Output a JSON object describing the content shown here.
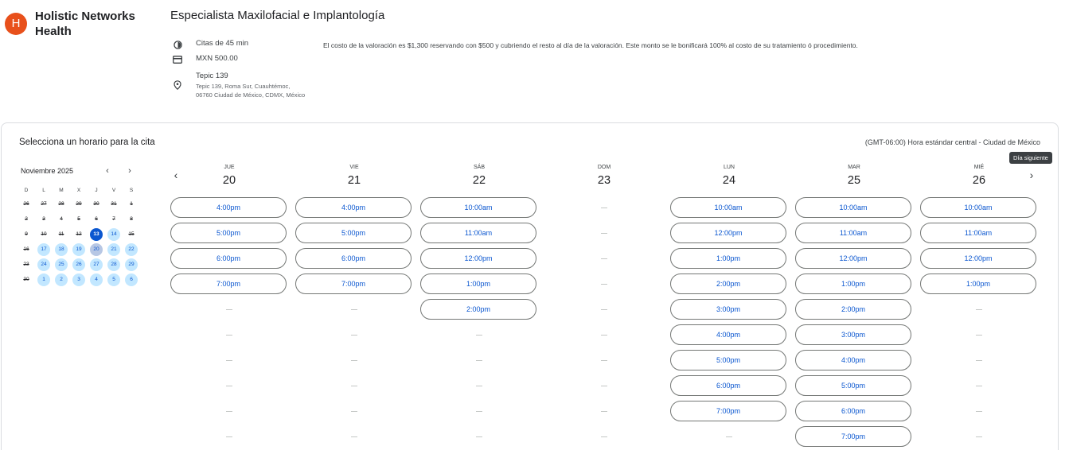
{
  "org": {
    "initial": "H",
    "name": "Holistic Networks Health"
  },
  "service": {
    "title": "Especialista Maxilofacial e Implantología",
    "duration": "Citas de 45 min",
    "price": "MXN 500.00",
    "location_name": "Tepic 139",
    "location_address": "Tepic 139, Roma Sur, Cuauhtémoc, 06760 Ciudad de México, CDMX, México",
    "description": "El costo de la valoración es $1,300 reservando con $500 y cubriendo el resto al día de la valoración. Este monto se le bonificará  100% al costo de su tratamiento ó procedimiento."
  },
  "panel": {
    "title": "Selecciona un horario para la cita",
    "timezone": "(GMT-06:00) Hora estándar central - Ciudad de México",
    "tooltip": "Día siguiente"
  },
  "calendar": {
    "month": "Noviembre 2025",
    "weekdays": [
      "D",
      "L",
      "M",
      "X",
      "J",
      "V",
      "S"
    ],
    "days": [
      {
        "d": "26",
        "state": "disabled"
      },
      {
        "d": "27",
        "state": "disabled"
      },
      {
        "d": "28",
        "state": "disabled"
      },
      {
        "d": "29",
        "state": "disabled"
      },
      {
        "d": "30",
        "state": "disabled"
      },
      {
        "d": "31",
        "state": "disabled"
      },
      {
        "d": "1",
        "state": "disabled"
      },
      {
        "d": "2",
        "state": "disabled"
      },
      {
        "d": "3",
        "state": "disabled"
      },
      {
        "d": "4",
        "state": "disabled"
      },
      {
        "d": "5",
        "state": "disabled"
      },
      {
        "d": "6",
        "state": "disabled"
      },
      {
        "d": "7",
        "state": "disabled"
      },
      {
        "d": "8",
        "state": "disabled"
      },
      {
        "d": "9",
        "state": "disabled"
      },
      {
        "d": "10",
        "state": "disabled"
      },
      {
        "d": "11",
        "state": "disabled"
      },
      {
        "d": "12",
        "state": "disabled"
      },
      {
        "d": "13",
        "state": "today"
      },
      {
        "d": "14",
        "state": "available"
      },
      {
        "d": "15",
        "state": "disabled"
      },
      {
        "d": "16",
        "state": "disabled"
      },
      {
        "d": "17",
        "state": "available"
      },
      {
        "d": "18",
        "state": "available"
      },
      {
        "d": "19",
        "state": "available"
      },
      {
        "d": "20",
        "state": "selected"
      },
      {
        "d": "21",
        "state": "available"
      },
      {
        "d": "22",
        "state": "available"
      },
      {
        "d": "23",
        "state": "disabled"
      },
      {
        "d": "24",
        "state": "available"
      },
      {
        "d": "25",
        "state": "available"
      },
      {
        "d": "26",
        "state": "available"
      },
      {
        "d": "27",
        "state": "available"
      },
      {
        "d": "28",
        "state": "available"
      },
      {
        "d": "29",
        "state": "available"
      },
      {
        "d": "30",
        "state": "disabled"
      },
      {
        "d": "1",
        "state": "available"
      },
      {
        "d": "2",
        "state": "available"
      },
      {
        "d": "3",
        "state": "available"
      },
      {
        "d": "4",
        "state": "available"
      },
      {
        "d": "5",
        "state": "available"
      },
      {
        "d": "6",
        "state": "available"
      }
    ]
  },
  "schedule": {
    "rows": 10,
    "days": [
      {
        "name": "JUE",
        "num": "20",
        "slots": [
          "4:00pm",
          "5:00pm",
          "6:00pm",
          "7:00pm"
        ]
      },
      {
        "name": "VIE",
        "num": "21",
        "slots": [
          "4:00pm",
          "5:00pm",
          "6:00pm",
          "7:00pm"
        ]
      },
      {
        "name": "SÁB",
        "num": "22",
        "slots": [
          "10:00am",
          "11:00am",
          "12:00pm",
          "1:00pm",
          "2:00pm"
        ]
      },
      {
        "name": "DOM",
        "num": "23",
        "slots": []
      },
      {
        "name": "LUN",
        "num": "24",
        "slots": [
          "10:00am",
          "12:00pm",
          "1:00pm",
          "2:00pm",
          "3:00pm",
          "4:00pm",
          "5:00pm",
          "6:00pm",
          "7:00pm"
        ]
      },
      {
        "name": "MAR",
        "num": "25",
        "slots": [
          "10:00am",
          "11:00am",
          "12:00pm",
          "1:00pm",
          "2:00pm",
          "3:00pm",
          "4:00pm",
          "5:00pm",
          "6:00pm",
          "7:00pm"
        ]
      },
      {
        "name": "MIÉ",
        "num": "26",
        "slots": [
          "10:00am",
          "11:00am",
          "12:00pm",
          "1:00pm"
        ]
      }
    ]
  },
  "icons": {
    "duration": "clock-half-icon",
    "price": "credit-card-icon",
    "location": "location-pin-icon",
    "prev_month": "chevron-left-icon",
    "next_month": "chevron-right-icon",
    "prev_day": "chevron-left-icon",
    "next_day": "chevron-right-icon"
  },
  "colors": {
    "brand": "#e8501b",
    "accent": "#0b57d0",
    "available": "#c2e7ff"
  }
}
